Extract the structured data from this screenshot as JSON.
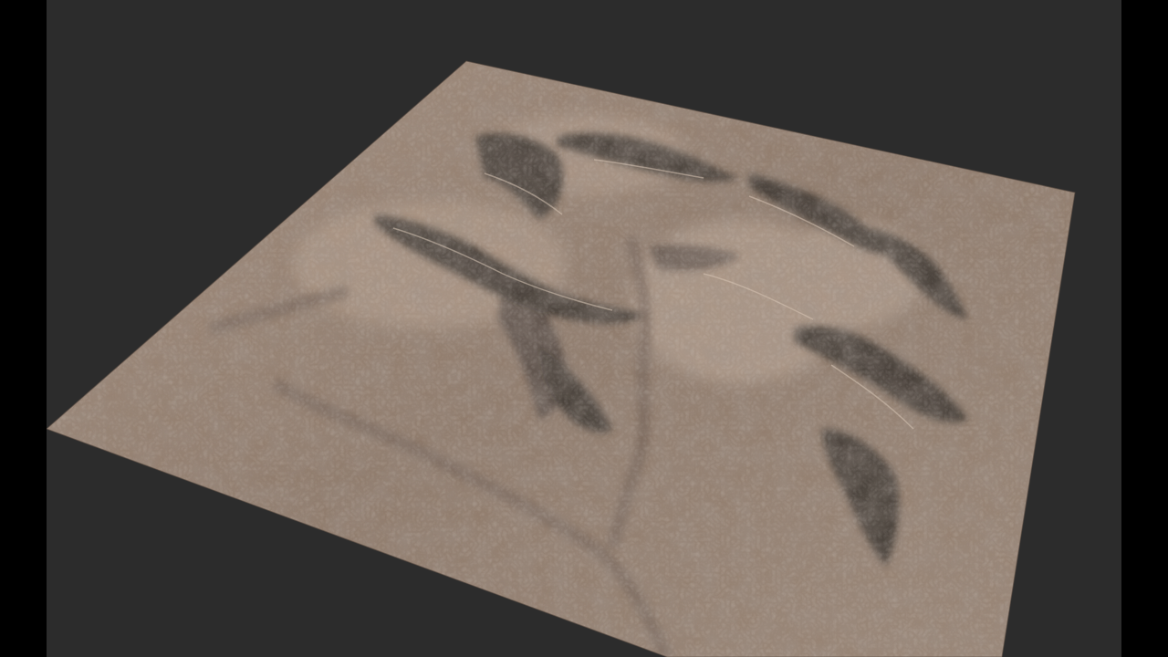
{
  "scene": {
    "subject": "terrain-heightmap-render",
    "colors": {
      "letterbox": "#000000",
      "viewport_background": "#2c2c2c",
      "terrain_base": "#8f7a6a",
      "terrain_light": "#b9a595",
      "terrain_dark": "#2f2a27",
      "terrain_mid": "#6f5f54"
    }
  }
}
